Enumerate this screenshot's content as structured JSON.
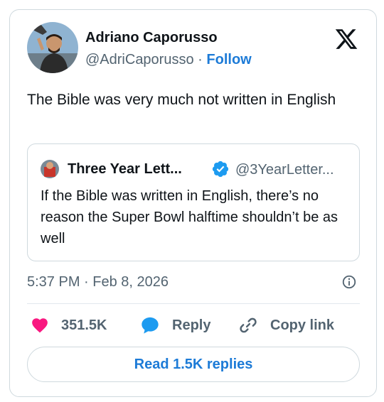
{
  "author": {
    "name": "Adriano Caporusso",
    "handle": "@AdriCaporusso",
    "separator": "·",
    "follow_label": "Follow"
  },
  "tweet": {
    "text": "The Bible was very much not written in English",
    "timestamp": "5:37 PM · Feb 8, 2026"
  },
  "quoted": {
    "name": "Three Year Lett...",
    "handle": "@3YearLetter...",
    "verified": true,
    "text": "If the Bible was written in English, there’s no reason the Super Bowl halftime shouldn’t be as well"
  },
  "actions": {
    "like_count": "351.5K",
    "reply_label": "Reply",
    "copy_label": "Copy link"
  },
  "read_replies_label": "Read 1.5K replies",
  "colors": {
    "text": "#0f1419",
    "secondary": "#536471",
    "link": "#1d7bd7",
    "like": "#f91880",
    "reply": "#1d9bf0",
    "border": "#cfd9de"
  },
  "icons": [
    "x-logo-icon",
    "verified-badge-icon",
    "info-icon",
    "heart-icon",
    "reply-bubble-icon",
    "link-icon"
  ]
}
